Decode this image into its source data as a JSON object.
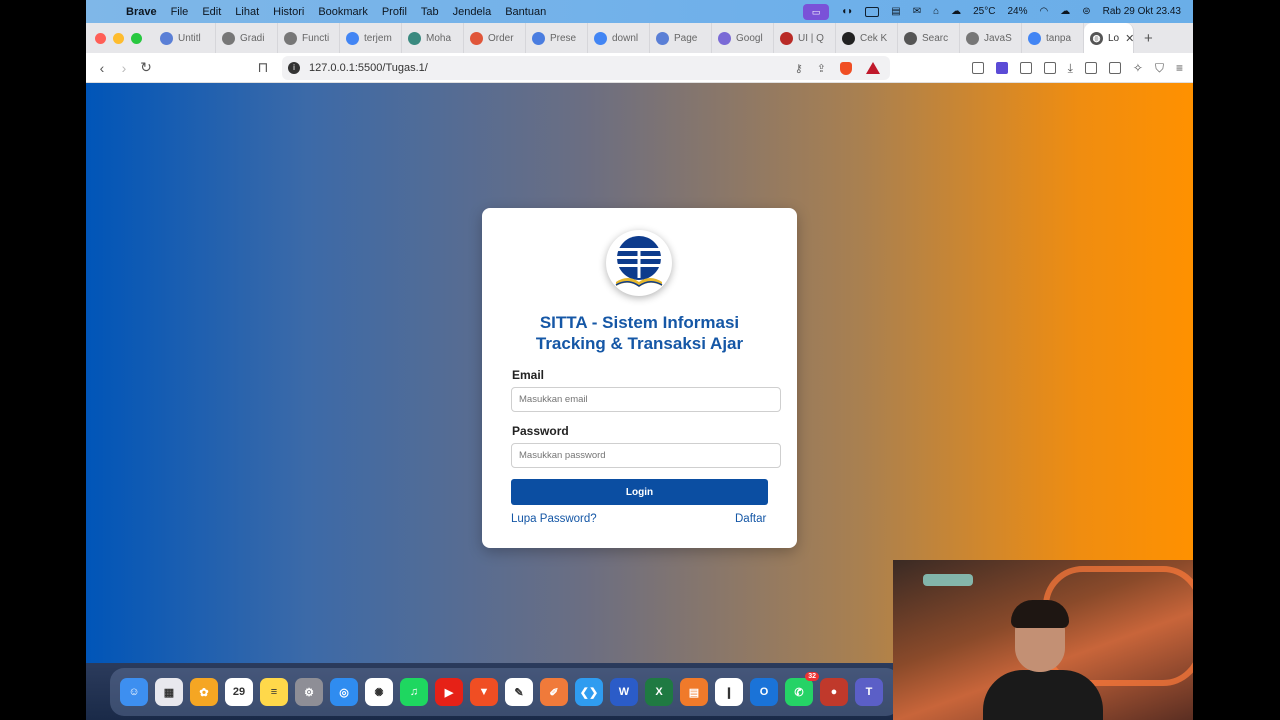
{
  "menubar": {
    "app_name": "Brave",
    "items": [
      "File",
      "Edit",
      "Lihat",
      "Histori",
      "Bookmark",
      "Profil",
      "Tab",
      "Jendela",
      "Bantuan"
    ],
    "weather": "25°C",
    "battery": "24%",
    "datetime": "Rab 29 Okt  23.43"
  },
  "tabs": [
    {
      "label": "Untitl",
      "icon": "brave-icon",
      "color": "#5a7fd6"
    },
    {
      "label": "Gradi",
      "icon": "gear-icon",
      "color": "#777777"
    },
    {
      "label": "Functi",
      "icon": "gear-icon",
      "color": "#777777"
    },
    {
      "label": "terjem",
      "icon": "google-icon",
      "color": "#4285f4"
    },
    {
      "label": "Moha",
      "icon": "chatgpt-icon",
      "color": "#3a8a80"
    },
    {
      "label": "Order",
      "icon": "figma-icon",
      "color": "#e0563a"
    },
    {
      "label": "Prese",
      "icon": "slides-icon",
      "color": "#4a7de0"
    },
    {
      "label": "downl",
      "icon": "google-icon",
      "color": "#4285f4"
    },
    {
      "label": "Page",
      "icon": "brave-icon",
      "color": "#5a7fd6"
    },
    {
      "label": "Googl",
      "icon": "gemini-icon",
      "color": "#7a6ad6"
    },
    {
      "label": "UI | Q",
      "icon": "quora-icon",
      "color": "#b92b27"
    },
    {
      "label": "Cek K",
      "icon": "medium-icon",
      "color": "#222222"
    },
    {
      "label": "Searc",
      "icon": "user-icon",
      "color": "#555555"
    },
    {
      "label": "JavaS",
      "icon": "gear-icon",
      "color": "#777777"
    },
    {
      "label": "tanpa",
      "icon": "google-icon",
      "color": "#4285f4"
    }
  ],
  "active_tab": {
    "label": "Lo",
    "icon": "globe-icon"
  },
  "toolbar": {
    "url": "127.0.0.1:5500/Tugas.1/"
  },
  "login": {
    "title_line1": "SITTA - Sistem Informasi",
    "title_line2": "Tracking & Transaksi Ajar",
    "email_label": "Email",
    "email_placeholder": "Masukkan email",
    "password_label": "Password",
    "password_placeholder": "Masukkan password",
    "login_button": "Login",
    "forgot_link": "Lupa Password?",
    "register_link": "Daftar"
  },
  "dock": {
    "apps": [
      {
        "name": "finder",
        "color": "#3d8ff0",
        "glyph": "☺"
      },
      {
        "name": "launchpad",
        "color": "#e8e8ee",
        "glyph": "▦"
      },
      {
        "name": "photos",
        "color": "#f5a623",
        "glyph": "✿"
      },
      {
        "name": "calendar",
        "color": "#ffffff",
        "glyph": "29"
      },
      {
        "name": "notes",
        "color": "#ffd84a",
        "glyph": "≡"
      },
      {
        "name": "settings",
        "color": "#8e8e96",
        "glyph": "⚙"
      },
      {
        "name": "safari",
        "color": "#2f8cf0",
        "glyph": "◎"
      },
      {
        "name": "chatgpt",
        "color": "#ffffff",
        "glyph": "✺"
      },
      {
        "name": "spotify",
        "color": "#1ed760",
        "glyph": "♫"
      },
      {
        "name": "youtube-music",
        "color": "#e62117",
        "glyph": "▶"
      },
      {
        "name": "brave",
        "color": "#f04e23",
        "glyph": "▼"
      },
      {
        "name": "bear",
        "color": "#ffffff",
        "glyph": "✎"
      },
      {
        "name": "pencil",
        "color": "#f07a3a",
        "glyph": "✐"
      },
      {
        "name": "vscode",
        "color": "#2f9cf0",
        "glyph": "❮❯"
      },
      {
        "name": "word",
        "color": "#2b5cc8",
        "glyph": "W"
      },
      {
        "name": "excel",
        "color": "#1f7a42",
        "glyph": "X"
      },
      {
        "name": "powerpoint-ish",
        "color": "#f07a2a",
        "glyph": "▤"
      },
      {
        "name": "books",
        "color": "#ffffff",
        "glyph": "❙"
      },
      {
        "name": "outlook",
        "color": "#1a73d8",
        "glyph": "O"
      },
      {
        "name": "whatsapp",
        "color": "#25d366",
        "glyph": "✆",
        "badge": "32"
      },
      {
        "name": "recorder",
        "color": "#c0392b",
        "glyph": "●"
      },
      {
        "name": "teams",
        "color": "#5b5fc7",
        "glyph": "T"
      }
    ]
  }
}
